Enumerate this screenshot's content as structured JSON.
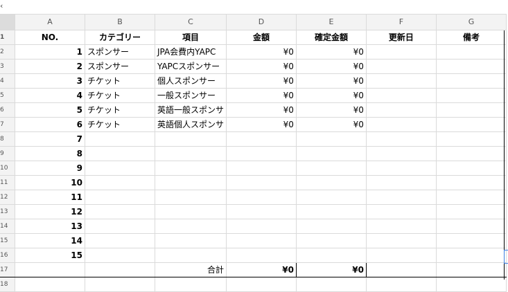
{
  "toolbar": {
    "chevron_glyph": "‹"
  },
  "columns": [
    "A",
    "B",
    "C",
    "D",
    "E",
    "F",
    "G"
  ],
  "headers": [
    "NO.",
    "カテゴリー",
    "項目",
    "金額",
    "確定金額",
    "更新日",
    "備考"
  ],
  "row_numbers": [
    "1",
    "2",
    "3",
    "4",
    "5",
    "6",
    "7",
    "8",
    "9",
    "10",
    "11",
    "12",
    "13",
    "14",
    "15",
    "16",
    "17",
    "18"
  ],
  "rows": [
    {
      "no": "1",
      "category": "スポンサー",
      "item": "JPA会費内YAPC",
      "amount": "¥0",
      "confirmed": "¥0",
      "updated": "",
      "notes": ""
    },
    {
      "no": "2",
      "category": "スポンサー",
      "item": "YAPCスポンサー",
      "amount": "¥0",
      "confirmed": "¥0",
      "updated": "",
      "notes": ""
    },
    {
      "no": "3",
      "category": "チケット",
      "item": "個人スポンサー",
      "amount": "¥0",
      "confirmed": "¥0",
      "updated": "",
      "notes": ""
    },
    {
      "no": "4",
      "category": "チケット",
      "item": "一般スポンサー",
      "amount": "¥0",
      "confirmed": "¥0",
      "updated": "",
      "notes": ""
    },
    {
      "no": "5",
      "category": "チケット",
      "item": "英語一般スポンサ",
      "amount": "¥0",
      "confirmed": "¥0",
      "updated": "",
      "notes": ""
    },
    {
      "no": "6",
      "category": "チケット",
      "item": "英語個人スポンサ",
      "amount": "¥0",
      "confirmed": "¥0",
      "updated": "",
      "notes": ""
    },
    {
      "no": "7",
      "category": "",
      "item": "",
      "amount": "",
      "confirmed": "",
      "updated": "",
      "notes": ""
    },
    {
      "no": "8",
      "category": "",
      "item": "",
      "amount": "",
      "confirmed": "",
      "updated": "",
      "notes": ""
    },
    {
      "no": "9",
      "category": "",
      "item": "",
      "amount": "",
      "confirmed": "",
      "updated": "",
      "notes": ""
    },
    {
      "no": "10",
      "category": "",
      "item": "",
      "amount": "",
      "confirmed": "",
      "updated": "",
      "notes": ""
    },
    {
      "no": "11",
      "category": "",
      "item": "",
      "amount": "",
      "confirmed": "",
      "updated": "",
      "notes": ""
    },
    {
      "no": "12",
      "category": "",
      "item": "",
      "amount": "",
      "confirmed": "",
      "updated": "",
      "notes": ""
    },
    {
      "no": "13",
      "category": "",
      "item": "",
      "amount": "",
      "confirmed": "",
      "updated": "",
      "notes": ""
    },
    {
      "no": "14",
      "category": "",
      "item": "",
      "amount": "",
      "confirmed": "",
      "updated": "",
      "notes": ""
    },
    {
      "no": "15",
      "category": "",
      "item": "",
      "amount": "",
      "confirmed": "",
      "updated": "",
      "notes": ""
    }
  ],
  "total": {
    "label": "合計",
    "amount": "¥0",
    "confirmed": "¥0"
  }
}
